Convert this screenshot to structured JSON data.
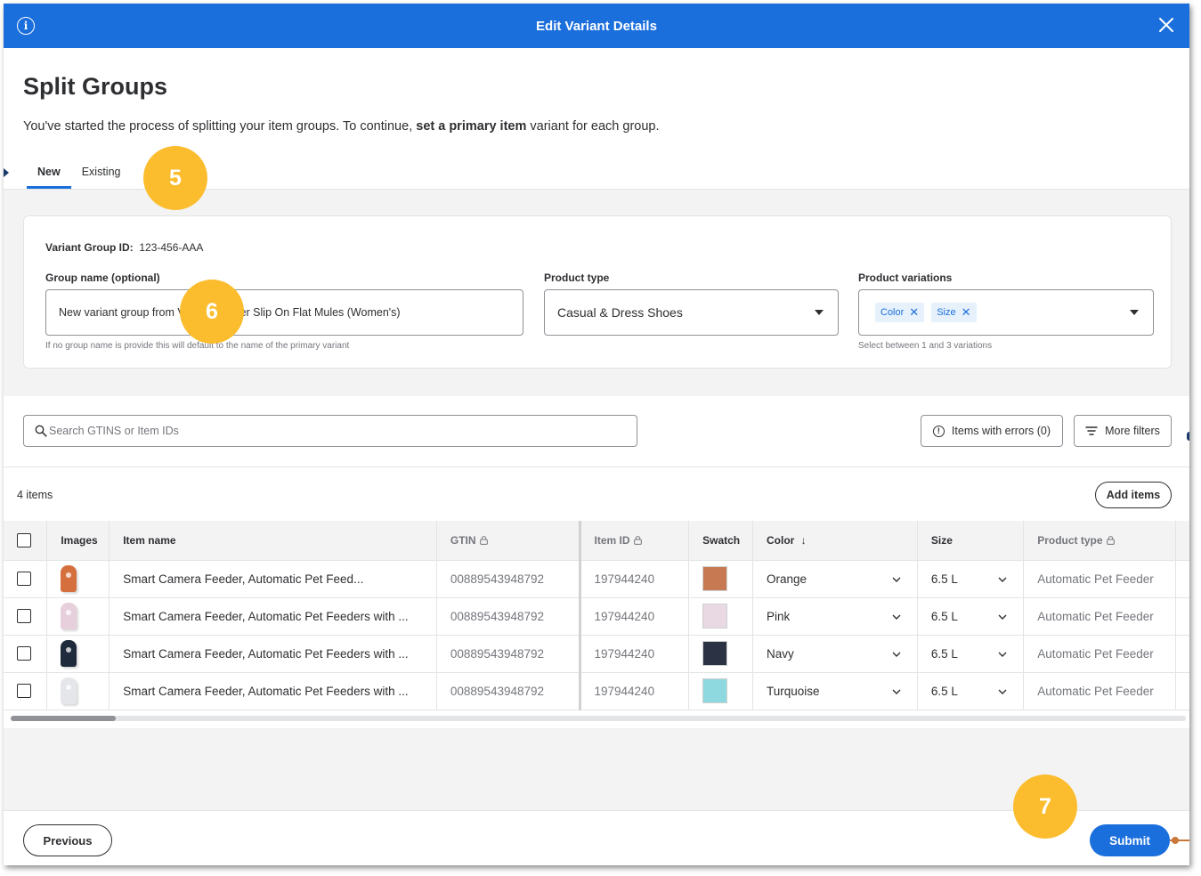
{
  "modal": {
    "title": "Edit Variant Details"
  },
  "page": {
    "heading": "Split Groups",
    "subtext_before": "You've started the process of splitting your item groups. To continue, ",
    "subtext_bold": "set a primary item",
    "subtext_after": " variant for each group."
  },
  "tabs": [
    {
      "label": "New",
      "active": true
    },
    {
      "label": "Existing",
      "active": false
    }
  ],
  "group": {
    "variant_group_id_label": "Variant Group ID:",
    "variant_group_id_value": "123-456-AAA",
    "group_name_label": "Group name (optional)",
    "group_name_value": "New variant group from Vegan Leather Slip On Flat Mules (Women's)",
    "group_name_hint": "If no group name is provide this will default to the name of the primary variant",
    "product_type_label": "Product type",
    "product_type_value": "Casual & Dress Shoes",
    "product_variations_label": "Product variations",
    "variation_chips": [
      "Color",
      "Size"
    ],
    "product_variations_hint": "Select between 1 and 3 variations"
  },
  "toolbar": {
    "search_placeholder": "Search GTINS or Item IDs",
    "errors_button": "Items with errors (0)",
    "filters_button": "More filters"
  },
  "items_section": {
    "count_label": "4 items",
    "add_items_button": "Add items"
  },
  "table": {
    "columns": {
      "images": "Images",
      "item_name": "Item name",
      "gtin": "GTIN",
      "item_id": "Item ID",
      "swatch": "Swatch",
      "color": "Color",
      "size": "Size",
      "product_type": "Product type"
    },
    "rows": [
      {
        "image_color": "#d5703e",
        "item_name": "Smart Camera Feeder, Automatic Pet Feed...",
        "gtin": "00889543948792",
        "item_id": "197944240",
        "swatch": "#c77a52",
        "color": "Orange",
        "size": "6.5 L",
        "product_type": "Automatic Pet Feeder"
      },
      {
        "image_color": "#e7cfdc",
        "item_name": "Smart Camera Feeder, Automatic Pet Feeders with ...",
        "gtin": "00889543948792",
        "item_id": "197944240",
        "swatch": "#e9d9e3",
        "color": "Pink",
        "size": "6.5 L",
        "product_type": "Automatic Pet Feeder"
      },
      {
        "image_color": "#1f2a3c",
        "item_name": "Smart Camera Feeder, Automatic Pet Feeders with ...",
        "gtin": "00889543948792",
        "item_id": "197944240",
        "swatch": "#2b3244",
        "color": "Navy",
        "size": "6.5 L",
        "product_type": "Automatic Pet Feeder"
      },
      {
        "image_color": "#e4e6ea",
        "item_name": "Smart Camera Feeder, Automatic Pet Feeders with ...",
        "gtin": "00889543948792",
        "item_id": "197944240",
        "swatch": "#8ed9df",
        "color": "Turquoise",
        "size": "6.5 L",
        "product_type": "Automatic Pet Feeder"
      }
    ]
  },
  "footer": {
    "previous_button": "Previous",
    "submit_button": "Submit"
  },
  "callouts": [
    "5",
    "6",
    "7"
  ],
  "colors": {
    "primary": "#1b6fdc",
    "callout": "#fbbd2e"
  }
}
